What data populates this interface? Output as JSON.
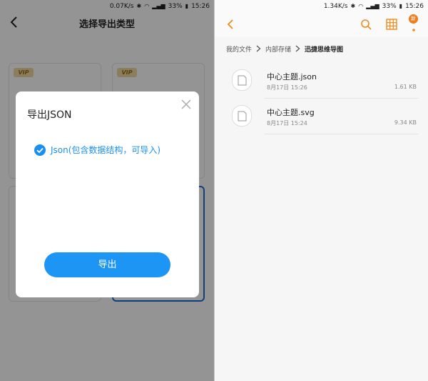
{
  "left": {
    "status": {
      "speed": "0.07K/s",
      "battery": "33%",
      "time": "15:26"
    },
    "header": {
      "title": "选择导出类型"
    },
    "cards": {
      "vip_badge": "VIP"
    },
    "dialog": {
      "title": "导出JSON",
      "option_label": "Json(包含数据结构，可导入)",
      "export_label": "导出"
    }
  },
  "right": {
    "status": {
      "speed": "1.34K/s",
      "battery": "33%",
      "time": "15:26"
    },
    "header": {
      "badge": "新"
    },
    "breadcrumb": [
      "我的文件",
      "内部存储",
      "迅捷思维导图"
    ],
    "files": [
      {
        "name": "中心主题.json",
        "date": "8月17日 15:26",
        "size": "1.61 KB"
      },
      {
        "name": "中心主题.svg",
        "date": "8月17日 15:24",
        "size": "9.34 KB"
      }
    ]
  },
  "colors": {
    "accent_blue": "#1d95f5",
    "accent_orange": "#ef7b1d"
  }
}
